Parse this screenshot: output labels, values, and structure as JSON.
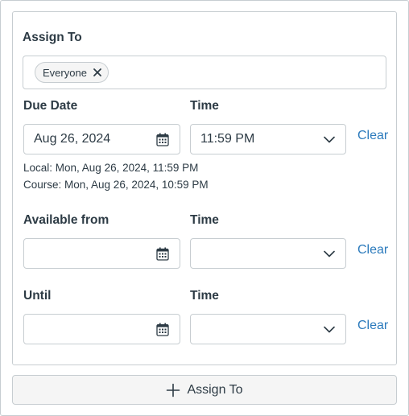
{
  "assign_section": {
    "label": "Assign To",
    "chips": [
      {
        "label": "Everyone",
        "icon": "close-icon"
      }
    ]
  },
  "due": {
    "date_label": "Due Date",
    "date_value": "Aug 26, 2024",
    "time_label": "Time",
    "time_value": "11:59 PM",
    "clear_label": "Clear",
    "local_note": "Local: Mon, Aug 26, 2024, 11:59 PM",
    "course_note": "Course: Mon, Aug 26, 2024, 10:59 PM"
  },
  "available_from": {
    "date_label": "Available from",
    "date_value": "",
    "time_label": "Time",
    "time_value": "",
    "clear_label": "Clear"
  },
  "until": {
    "date_label": "Until",
    "date_value": "",
    "time_label": "Time",
    "time_value": "",
    "clear_label": "Clear"
  },
  "add_button": {
    "label": "Assign To",
    "icon": "plus-icon"
  },
  "colors": {
    "link": "#2b7abc",
    "text": "#2d3b45",
    "border": "#c7cdd1",
    "button_bg": "#f5f5f5"
  }
}
